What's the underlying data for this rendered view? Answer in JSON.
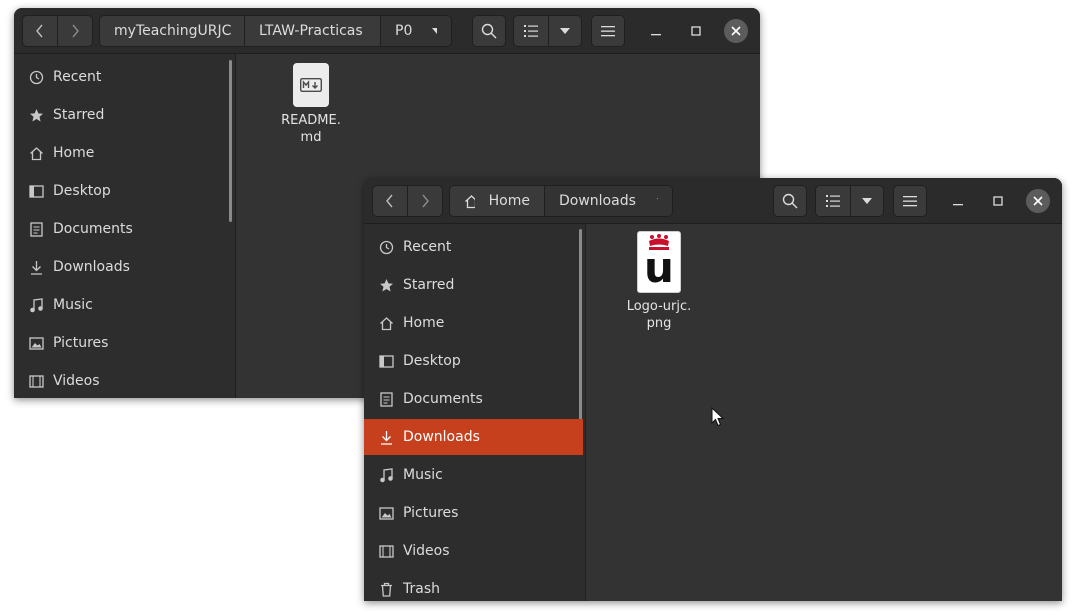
{
  "windows": [
    {
      "path": [
        "myTeachingURJC",
        "LTAW-Practicas",
        "P0"
      ],
      "sidebar": [
        "Recent",
        "Starred",
        "Home",
        "Desktop",
        "Documents",
        "Downloads",
        "Music",
        "Pictures",
        "Videos"
      ],
      "files": [
        {
          "label": "README.\nmd",
          "icon": "markdown-file-icon"
        }
      ]
    },
    {
      "path": [
        "Home",
        "Downloads"
      ],
      "active_item": "Downloads",
      "sidebar": [
        "Recent",
        "Starred",
        "Home",
        "Desktop",
        "Documents",
        "Downloads",
        "Music",
        "Pictures",
        "Videos",
        "Trash"
      ],
      "files": [
        {
          "label": "Logo-urjc.\npng",
          "icon": "image-file-icon",
          "logo_letter": "u"
        }
      ]
    }
  ],
  "colors": {
    "accent": "#c7401e",
    "logo_red": "#c8102e",
    "header": "#2b2b2b",
    "sidebar": "#2d2d2d",
    "content": "#333333"
  }
}
